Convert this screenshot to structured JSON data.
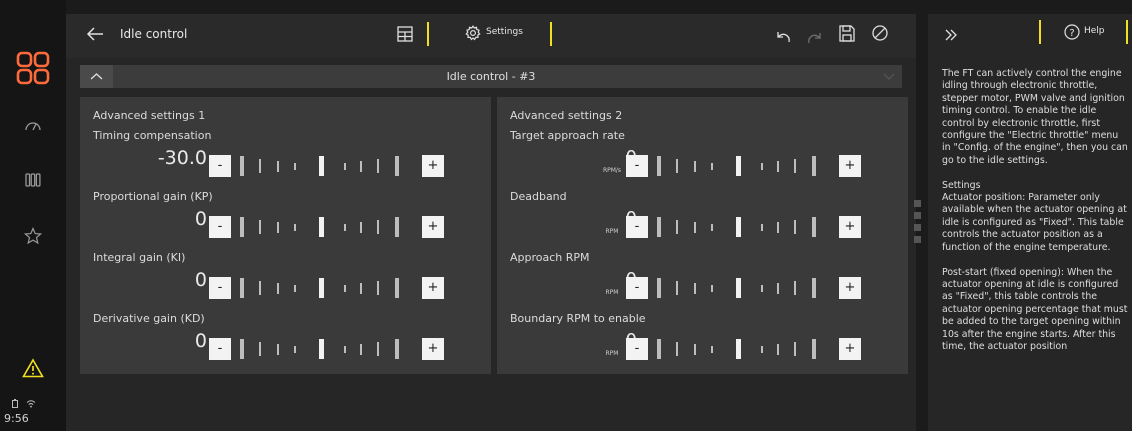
{
  "header": {
    "back_label": "Idle control",
    "settings_label": "Settings"
  },
  "section": {
    "title": "Idle control - #3"
  },
  "panel1": {
    "title": "Advanced settings 1",
    "rows": [
      {
        "label": "Timing compensation",
        "value": "-30.0",
        "unit": ""
      },
      {
        "label": "Proportional gain (KP)",
        "value": "0",
        "unit": ""
      },
      {
        "label": "Integral gain (KI)",
        "value": "0",
        "unit": ""
      },
      {
        "label": "Derivative gain (KD)",
        "value": "0",
        "unit": ""
      }
    ]
  },
  "panel2": {
    "title": "Advanced settings 2",
    "rows": [
      {
        "label": "Target approach rate",
        "value": "0",
        "unit": "RPM/s"
      },
      {
        "label": "Deadband",
        "value": "0",
        "unit": "RPM"
      },
      {
        "label": "Approach RPM",
        "value": "0",
        "unit": "RPM"
      },
      {
        "label": "Boundary RPM to enable",
        "value": "0",
        "unit": "RPM"
      }
    ]
  },
  "buttons": {
    "minus": "-",
    "plus": "+"
  },
  "help": {
    "label": "Help",
    "text": "The FT can actively control the engine idling through electronic throttle, stepper motor, PWM valve and ignition timing control. To enable the idle control by electronic throttle, first configure the \"Electric throttle\" menu in \"Config. of the engine\", then you can go to the idle settings.\n\nSettings\nActuator position: Parameter only available when the actuator opening at idle is configured as \"Fixed\". This table controls the actuator position as a function of the engine temperature.\n\nPost-start (fixed opening): When the actuator opening at idle is configured as \"Fixed\", this table controls the actuator opening percentage that must be added to the target opening within 10s after the engine starts. After this time, the actuator position"
  },
  "status": {
    "time": "9:56"
  },
  "colors": {
    "accent": "#f0e020",
    "warning": "#f0e020",
    "menu_icon": "#ff6a3d"
  },
  "icons": [
    "menu-grid-icon",
    "dashboard-icon",
    "gauges-icon",
    "favorites-icon",
    "warning-icon",
    "back-arrow-icon",
    "table-icon",
    "gear-icon",
    "undo-icon",
    "redo-icon",
    "save-icon",
    "cancel-icon",
    "collapse-icon",
    "expand-panel-icon",
    "help-icon"
  ]
}
